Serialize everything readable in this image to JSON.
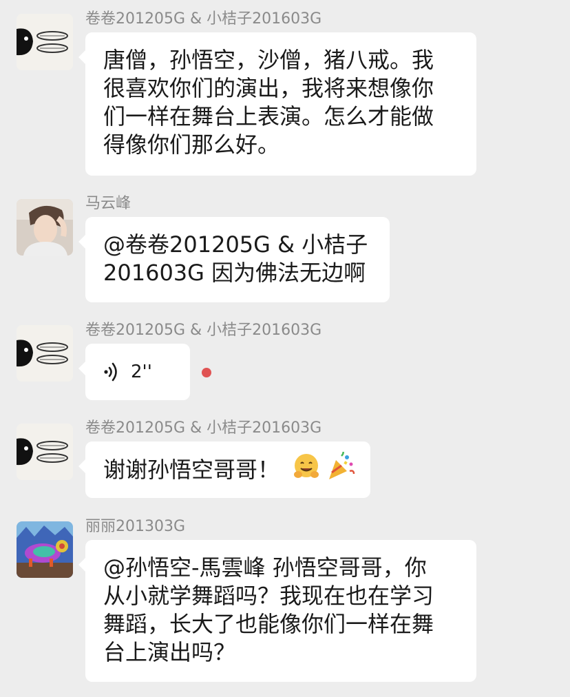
{
  "messages": [
    {
      "sender": "卷卷201205G & 小桔子201603G",
      "avatar": "bunny-avatar",
      "lines": [
        "唐僧，孙悟空，沙僧，猪八戒。我",
        "很喜欢你们的演出，我将来想像你",
        "们一样在舞台上表演。怎么才能做",
        "得像你们那么好。"
      ]
    },
    {
      "sender": "马云峰",
      "avatar": "person-avatar",
      "lines": [
        "@卷卷201205G & 小桔子",
        "201603G 因为佛法无边啊"
      ]
    },
    {
      "sender": "卷卷201205G & 小桔子201603G",
      "avatar": "bunny-avatar",
      "voice": {
        "duration": "2''",
        "icon": "voice-wave-icon",
        "unread": true
      }
    },
    {
      "sender": "卷卷201205G & 小桔子201603G",
      "avatar": "bunny-avatar",
      "text": "谢谢孙悟空哥哥！",
      "emojis": [
        "hugging-face-emoji",
        "party-popper-emoji"
      ]
    },
    {
      "sender": "丽丽201303G",
      "avatar": "painting-avatar",
      "lines": [
        "@孙悟空-馬雲峰 孙悟空哥哥，你",
        "从小就学舞蹈吗？我现在也在学习",
        "舞蹈，长大了也能像你们一样在舞",
        "台上演出吗？"
      ]
    }
  ],
  "colors": {
    "background": "#ededed",
    "bubble": "#ffffff",
    "sender_text": "#8a8a8a",
    "unread_dot": "#e05353"
  }
}
